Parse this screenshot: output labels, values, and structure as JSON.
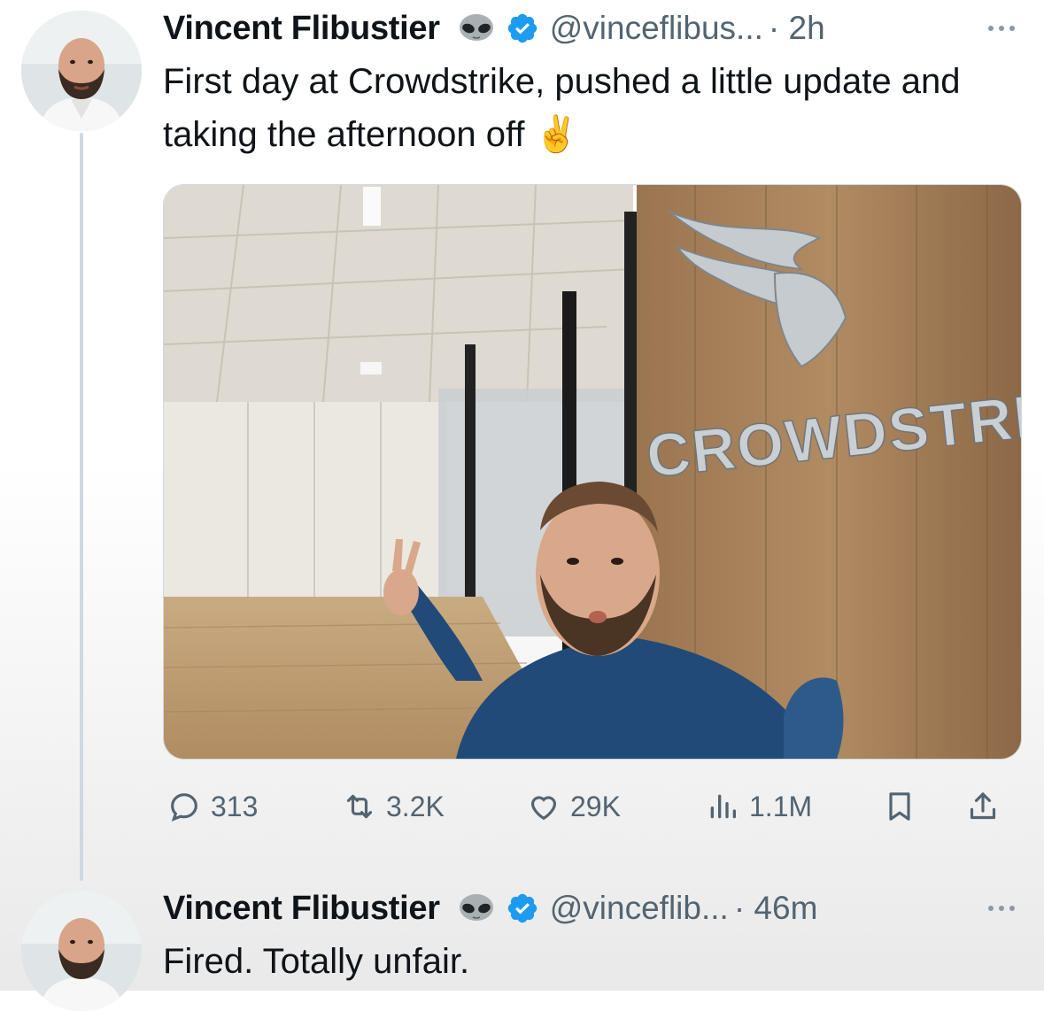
{
  "tweets": [
    {
      "author_name": "Vincent Flibustier",
      "handle": "@vinceflibus...",
      "time": "· 2h",
      "text": "First day at Crowdstrike, pushed a little update and taking the afternoon off ✌️",
      "media_sign_text": "CROWDSTRIKE",
      "metrics": {
        "replies": "313",
        "reposts": "3.2K",
        "likes": "29K",
        "views": "1.1M"
      }
    },
    {
      "author_name": "Vincent Flibustier",
      "handle": "@vinceflib...",
      "time": "· 46m",
      "text": "Fired. Totally unfair."
    }
  ],
  "icons": {
    "alien": "alien-emoji-icon",
    "verified": "verified-badge-icon",
    "more": "more-options-icon",
    "reply": "reply-icon",
    "repost": "repost-icon",
    "like": "like-icon",
    "views": "views-icon",
    "bookmark": "bookmark-icon",
    "share": "share-icon"
  },
  "colors": {
    "verified": "#1d9bf0",
    "secondary_text": "#536471",
    "thread_line": "#cfd9de"
  }
}
